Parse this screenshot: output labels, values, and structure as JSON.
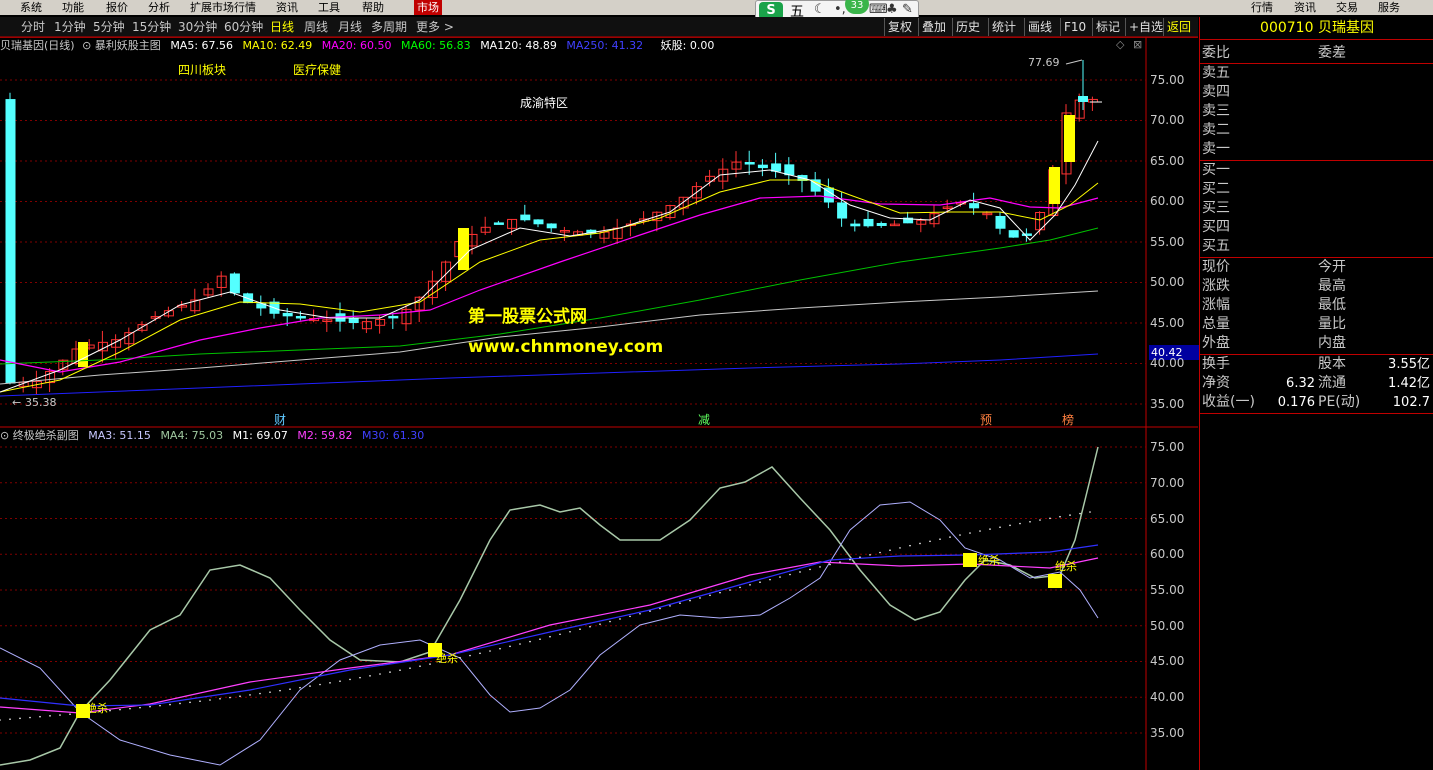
{
  "menu": {
    "items": [
      "系统",
      "功能",
      "报价",
      "分析",
      "扩展市场行情",
      "资讯",
      "工具",
      "帮助",
      "市场"
    ],
    "active_index": 8,
    "right_items": [
      "行情",
      "资讯",
      "交易",
      "服务"
    ]
  },
  "float_toolbar": {
    "badge": "五",
    "badge_count": "33"
  },
  "toolbar": {
    "periods": [
      "分时",
      "1分钟",
      "5分钟",
      "15分钟",
      "30分钟",
      "60分钟",
      "日线",
      "周线",
      "月线",
      "多周期",
      "更多 >"
    ],
    "selected_index": 6,
    "right_buttons": [
      "复权",
      "叠加",
      "历史",
      "统计",
      "画线",
      "F10",
      "标记",
      "+自选",
      "返回"
    ]
  },
  "stock": {
    "code": "000710",
    "name": "贝瑞基因",
    "title": "000710 贝瑞基因"
  },
  "main_chart": {
    "header_prefix": "贝瑞基因(日线)",
    "formula_name": "暴利妖股主图",
    "indicators": [
      {
        "label": "MA5: 67.56",
        "color": "#ffffff"
      },
      {
        "label": "MA10: 62.49",
        "color": "#ffff00"
      },
      {
        "label": "MA20: 60.50",
        "color": "#ff00ff"
      },
      {
        "label": "MA60: 56.83",
        "color": "#00ff00"
      },
      {
        "label": "MA120: 48.89",
        "color": "#ffffff"
      },
      {
        "label": "MA250: 41.32",
        "color": "#4040ff"
      },
      {
        "label": "妖股: 0.00",
        "color": "#ffffff"
      }
    ],
    "annotations": {
      "sector1": "四川板块",
      "sector2": "医疗保健",
      "sector3": "成渝特区",
      "high_price": "77.69",
      "low_price": "35.38",
      "current_price_tag": "40.42"
    },
    "event_markers": [
      "财",
      "减",
      "预",
      "榜"
    ],
    "yaxis_labels": [
      "75.00",
      "70.00",
      "65.00",
      "60.00",
      "55.00",
      "50.00",
      "45.00",
      "40.00",
      "35.00"
    ]
  },
  "sub_chart": {
    "title": "终极绝杀副图",
    "indicators": [
      {
        "label": "MA3: 51.15",
        "color": "#c8c8ff"
      },
      {
        "label": "MA4: 75.03",
        "color": "#a0c8a0"
      },
      {
        "label": "M1: 69.07",
        "color": "#ffffff"
      },
      {
        "label": "M2: 59.82",
        "color": "#ff40ff"
      },
      {
        "label": "M30: 61.30",
        "color": "#4040ff"
      }
    ],
    "signal_label": "绝杀",
    "yaxis_labels": [
      "75.00",
      "70.00",
      "65.00",
      "60.00",
      "55.00",
      "50.00",
      "45.00",
      "40.00",
      "35.00"
    ]
  },
  "watermark": {
    "line1": "第一股票公式网",
    "line2": "www.chnmoney.com"
  },
  "quote_panel": {
    "header": [
      "委比",
      "委差"
    ],
    "sell": [
      "卖五",
      "卖四",
      "卖三",
      "卖二",
      "卖一"
    ],
    "buy": [
      "买一",
      "买二",
      "买三",
      "买四",
      "买五"
    ],
    "stats_left": [
      "现价",
      "涨跌",
      "涨幅",
      "总量",
      "外盘"
    ],
    "stats_right": [
      "今开",
      "最高",
      "最低",
      "量比",
      "内盘"
    ],
    "fin": [
      {
        "label": "换手",
        "label2": "股本",
        "value2": "3.55亿"
      },
      {
        "label": "净资",
        "value": "6.32",
        "label2": "流通",
        "value2": "1.42亿"
      },
      {
        "label": "收益(一)",
        "value": "0.176",
        "label2": "PE(动)",
        "value2": "102.7"
      }
    ]
  },
  "colors": {
    "up": "#ff3232",
    "down": "#54ffff",
    "yang_bar": "#ffff00",
    "ma5": "#ffffff",
    "ma10": "#ffff00",
    "ma20": "#ff00ff",
    "ma60": "#00c000",
    "ma120": "#c8c8c8",
    "ma250": "#2020ff",
    "grid": "#800000",
    "accent": "#c00000"
  }
}
